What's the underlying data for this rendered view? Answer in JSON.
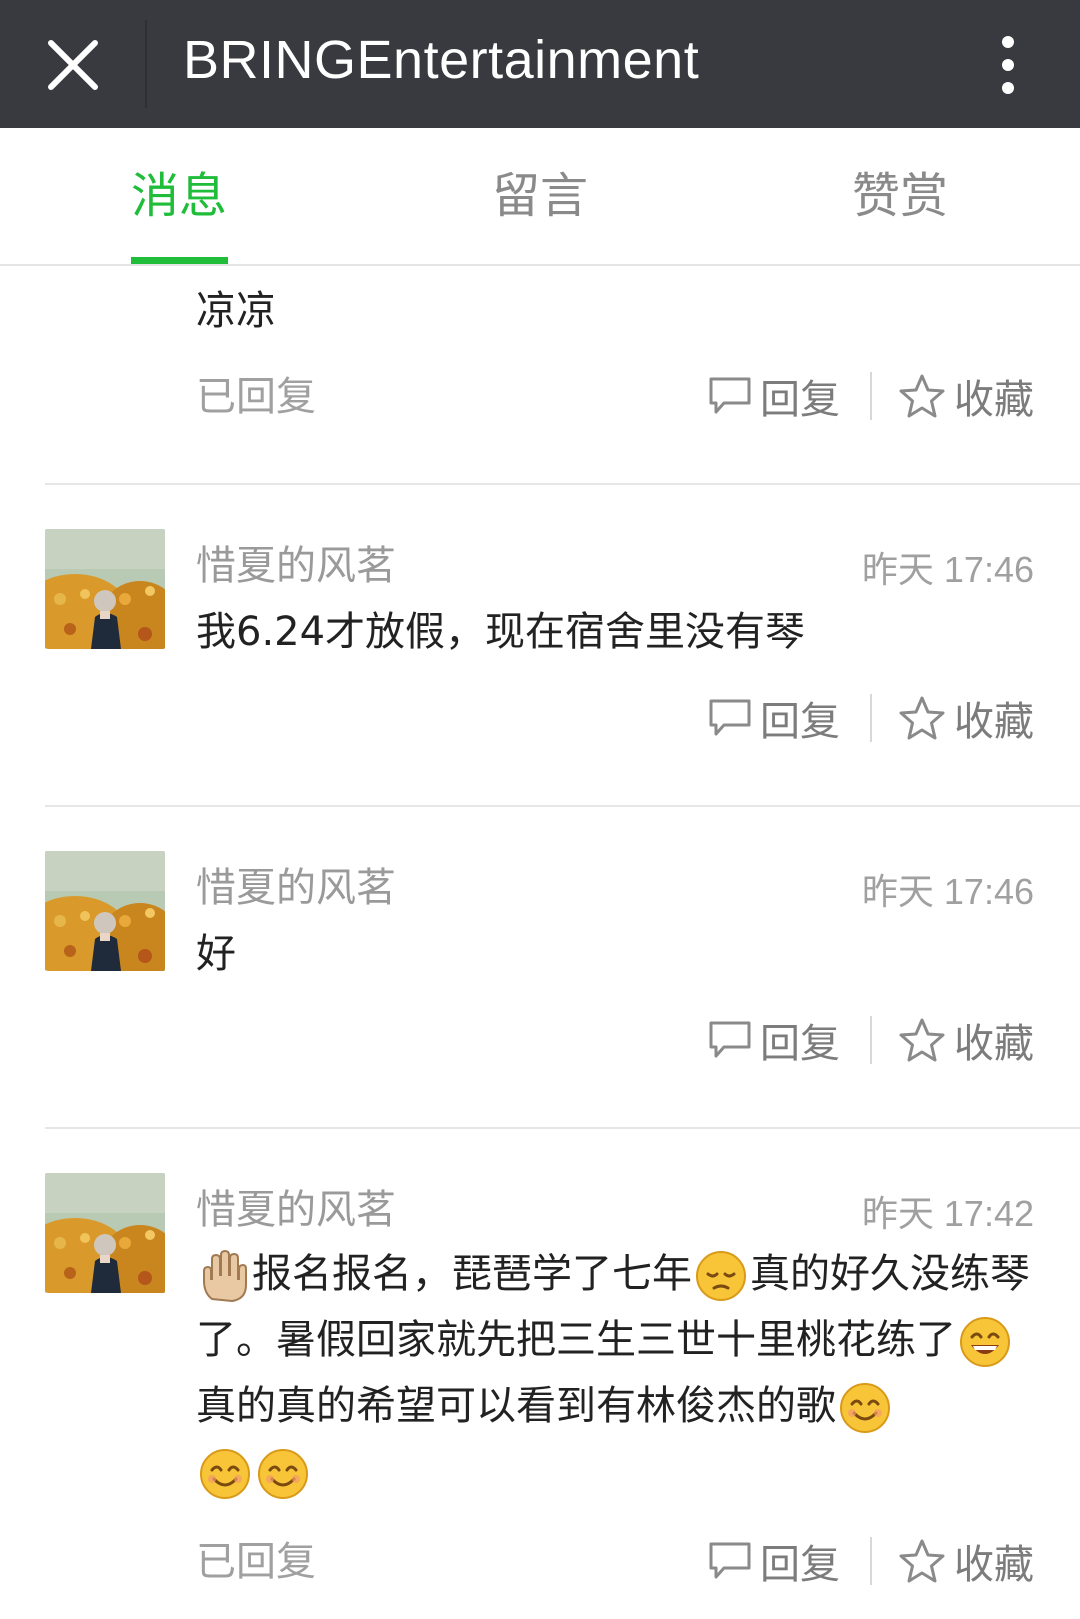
{
  "header": {
    "title": "BRINGEntertainment",
    "close_icon": "close-icon",
    "more_icon": "more-vertical-icon",
    "background": "#383a3f"
  },
  "tabs": [
    {
      "label": "消息",
      "active": true
    },
    {
      "label": "留言",
      "active": false
    },
    {
      "label": "赞赏",
      "active": false
    }
  ],
  "accent_color": "#1fbd3a",
  "messages": [
    {
      "text": "凉凉",
      "status": "已回复",
      "reply_label": "回复",
      "favorite_label": "收藏"
    },
    {
      "name": "惜夏的风茗",
      "time": "昨天 17:46",
      "text": "我6.24才放假，现在宿舍里没有琴",
      "reply_label": "回复",
      "favorite_label": "收藏"
    },
    {
      "name": "惜夏的风茗",
      "time": "昨天 17:46",
      "text": "好",
      "reply_label": "回复",
      "favorite_label": "收藏"
    },
    {
      "name": "惜夏的风茗",
      "time": "昨天 17:42",
      "text_parts": [
        "报名报名，琵琶学了七年",
        "真的好久没练琴了。暑假回家就先把三生三世十里桃花练了",
        "真的真的希望可以看到有林俊杰的歌"
      ],
      "emojis": [
        "raised-hand-emoji",
        "pensive-face-emoji",
        "grinning-face-emoji",
        "smiling-face-emoji",
        "smiling-face-emoji",
        "smiling-face-emoji"
      ],
      "status": "已回复",
      "reply_label": "回复",
      "favorite_label": "收藏"
    }
  ]
}
